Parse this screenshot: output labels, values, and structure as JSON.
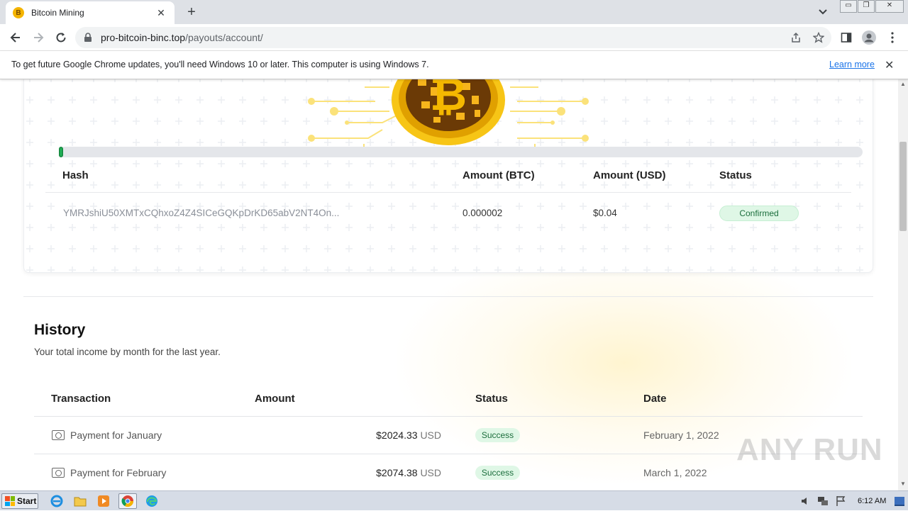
{
  "browser": {
    "tab_title": "Bitcoin Mining",
    "tab_favicon_letter": "B",
    "new_tab_icon": "plus-icon",
    "url_host": "pro-bitcoin-binc.top",
    "url_path": "/payouts/account/"
  },
  "infobar": {
    "message": "To get future Google Chrome updates, you'll need Windows 10 or later. This computer is using Windows 7.",
    "link": "Learn more"
  },
  "card": {
    "progress_fraction": 0.004,
    "columns": [
      "Hash",
      "Amount (BTC)",
      "Amount (USD)",
      "Status"
    ],
    "row": {
      "hash": "YMRJshiU50XMTxCQhxoZ4Z4SICeGQKpDrKD65abV2NT4On...",
      "btc": "0.000002",
      "usd": "$0.04",
      "status": "Confirmed"
    }
  },
  "history": {
    "title": "History",
    "subtitle": "Your total income by month for the last year.",
    "columns": [
      "Transaction",
      "Amount",
      "Status",
      "Date"
    ],
    "rows": [
      {
        "label": "Payment for January",
        "amount": "$2024.33",
        "currency": "USD",
        "status": "Success",
        "date": "February 1, 2022"
      },
      {
        "label": "Payment for February",
        "amount": "$2074.38",
        "currency": "USD",
        "status": "Success",
        "date": "March 1, 2022"
      }
    ]
  },
  "watermark": "ANY RUN",
  "taskbar": {
    "start_label": "Start",
    "clock": "6:12 AM"
  },
  "colors": {
    "accent_green": "#22b85a",
    "link_blue": "#1a73e8",
    "coin_gold": "#f4b400"
  }
}
